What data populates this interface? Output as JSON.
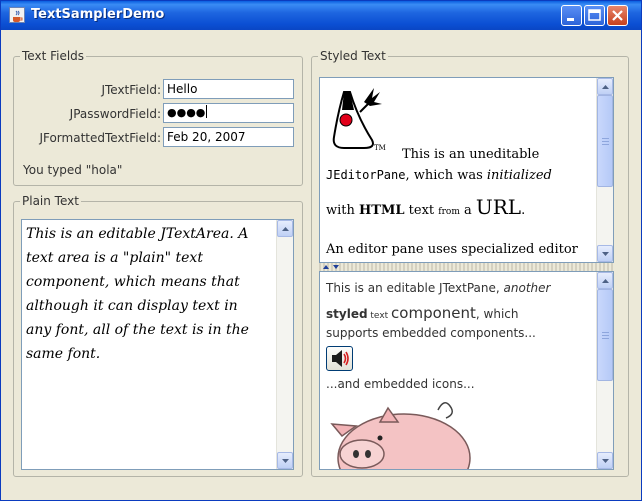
{
  "window": {
    "title": "TextSamplerDemo"
  },
  "text_fields": {
    "legend": "Text Fields",
    "jtextfield_label": "JTextField:",
    "jtextfield_value": "Hello",
    "jpassword_label": "JPasswordField:",
    "jpassword_value": "●●●●",
    "jformatted_label": "JFormattedTextField:",
    "jformatted_value": "Feb 20, 2007",
    "status": "You typed \"hola\""
  },
  "plain_text": {
    "legend": "Plain Text",
    "lines": [
      "This is an editable JTextArea. A",
      "text area is a \"plain\" text",
      "component, which means that",
      "although it can display text in",
      "any font, all of the text is in the",
      "same font."
    ]
  },
  "styled_text": {
    "legend": "Styled Text",
    "editor_pane": {
      "tm": "TM",
      "line1": "This is an uneditable",
      "code": "JEditorPane",
      "line2a": ", which was ",
      "line2b": "initialized",
      "with": "with ",
      "html": "HTML",
      "text": " text ",
      "from": "from",
      "a": " a ",
      "url": "URL",
      "period": ".",
      "line4": "An editor pane uses specialized editor"
    },
    "text_pane": {
      "l1a": "This is an editable JTextPane, ",
      "l1b": "another",
      "l2a": "styled",
      "l2b": " text ",
      "l2c": "component",
      "l2d": ", which",
      "l3": "supports embedded components...",
      "l4": "...and embedded icons..."
    }
  },
  "icons": [
    "java-cup-icon",
    "minimize-icon",
    "maximize-icon",
    "close-icon",
    "duke-icon",
    "speaker-icon",
    "pig-icon"
  ],
  "colors": {
    "titlebar": "#0a5ee0",
    "window_bg": "#ece9d8",
    "field_border": "#7f9db9"
  }
}
